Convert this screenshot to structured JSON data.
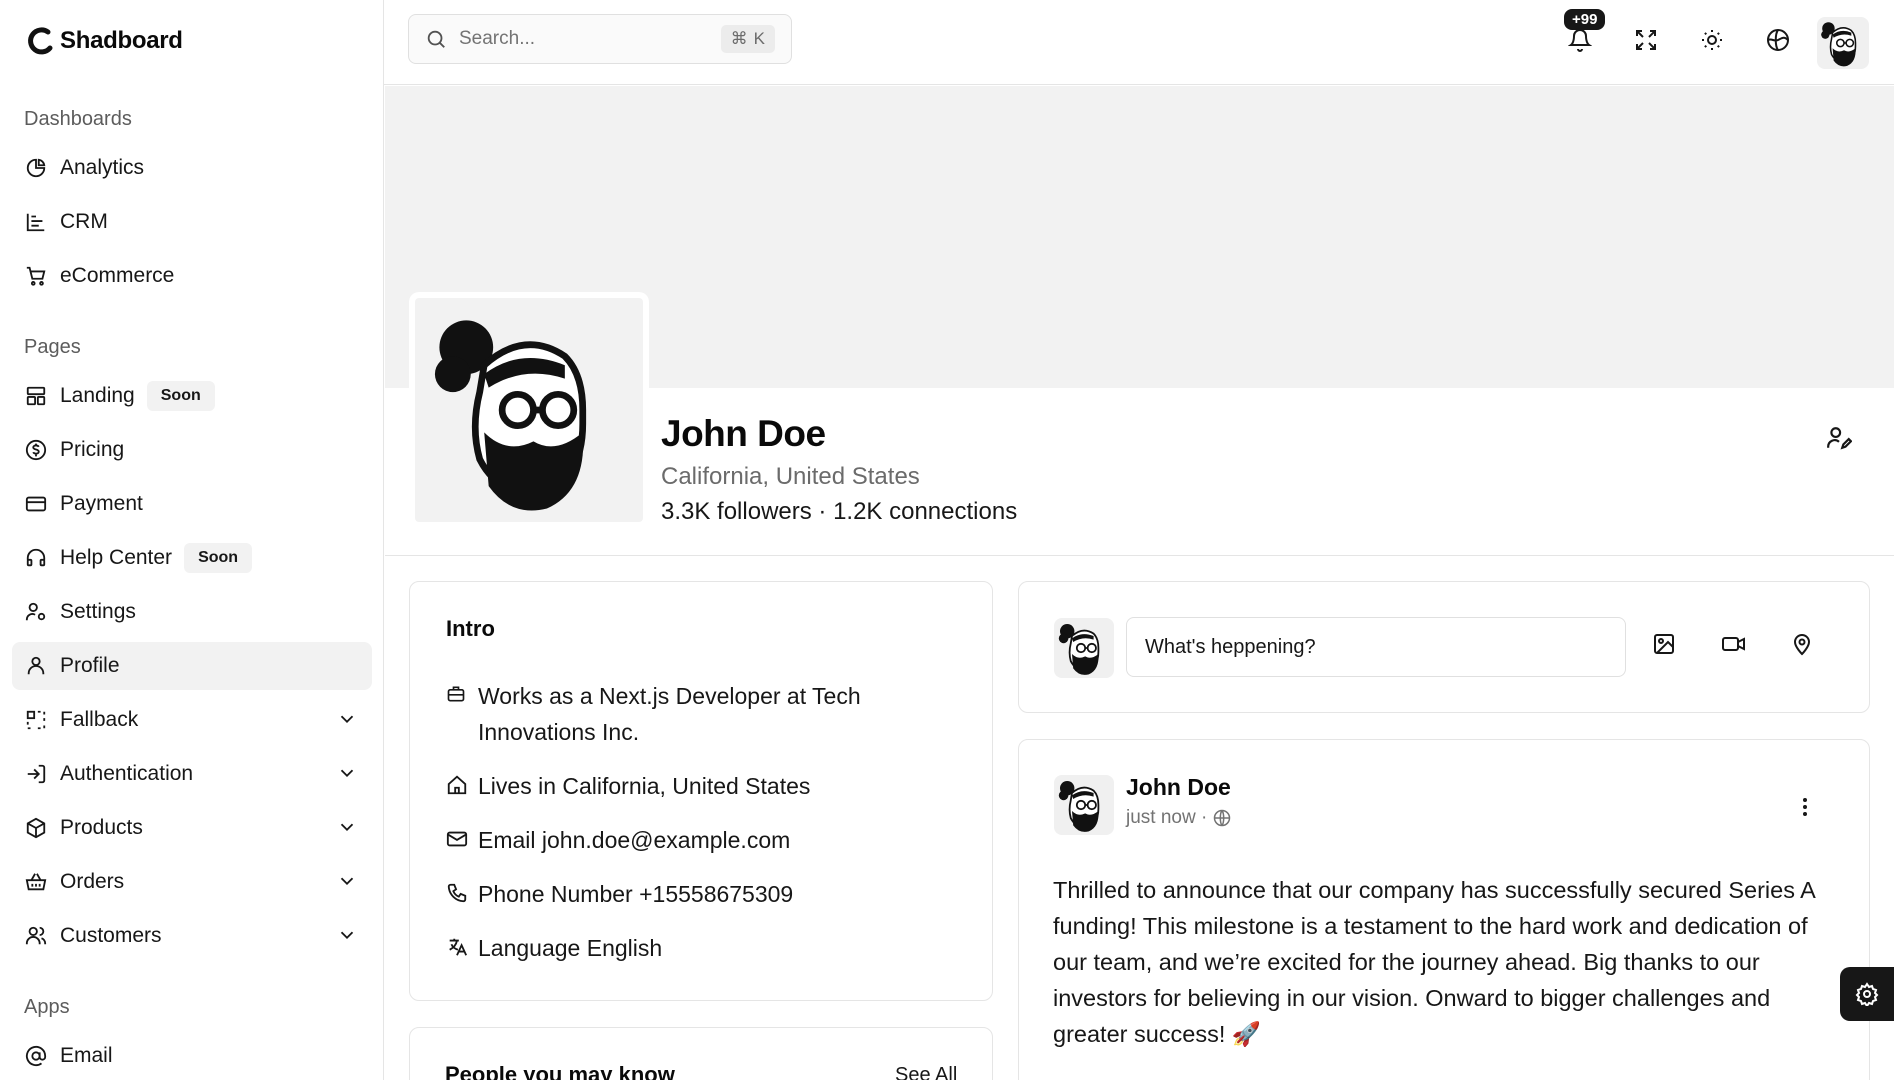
{
  "brand": {
    "name": "Shadboard"
  },
  "sidebar": {
    "groups": [
      {
        "label": "Dashboards"
      },
      {
        "label": "Pages"
      },
      {
        "label": "Apps"
      }
    ],
    "items": [
      {
        "label": "Analytics",
        "icon": "pie-chart-icon"
      },
      {
        "label": "CRM",
        "icon": "bar-chart-icon"
      },
      {
        "label": "eCommerce",
        "icon": "cart-icon"
      },
      {
        "label": "Landing",
        "icon": "layout-icon",
        "badge": "Soon"
      },
      {
        "label": "Pricing",
        "icon": "dollar-circle-icon"
      },
      {
        "label": "Payment",
        "icon": "credit-card-icon"
      },
      {
        "label": "Help Center",
        "icon": "headset-icon",
        "badge": "Soon"
      },
      {
        "label": "Settings",
        "icon": "user-cog-icon"
      },
      {
        "label": "Profile",
        "icon": "user-icon",
        "active": true
      },
      {
        "label": "Fallback",
        "icon": "fallback-icon",
        "expandable": true
      },
      {
        "label": "Authentication",
        "icon": "login-icon",
        "expandable": true
      },
      {
        "label": "Products",
        "icon": "package-icon",
        "expandable": true
      },
      {
        "label": "Orders",
        "icon": "basket-icon",
        "expandable": true
      },
      {
        "label": "Customers",
        "icon": "users-icon",
        "expandable": true
      },
      {
        "label": "Email",
        "icon": "at-sign-icon"
      }
    ]
  },
  "topbar": {
    "search_placeholder": "Search...",
    "shortcut_symbol": "⌘",
    "shortcut_key": "K",
    "notifications_badge": "+99"
  },
  "profile": {
    "name": "John Doe",
    "location": "California, United States",
    "stats": "3.3K followers · 1.2K connections"
  },
  "intro": {
    "title": "Intro",
    "work_line1": "Works as a Next.js Developer at Tech",
    "work_line2": "Innovations Inc.",
    "lives": "Lives in California, United States",
    "email": "Email john.doe@example.com",
    "phone": "Phone Number +15558675309",
    "language": "Language English"
  },
  "composer": {
    "placeholder": "What's heppening?"
  },
  "post": {
    "author": "John Doe",
    "time": "just now ·",
    "text": "Thrilled to announce that our company has successfully secured Series A funding! This milestone is a testament to the hard work and dedication of our team, and we’re excited for the journey ahead. Big thanks to our investors for believing in our vision. Onward to bigger challenges and greater success! 🚀"
  },
  "people": {
    "title": "People you may know",
    "see_all": "See All"
  },
  "colors": {
    "accent": "#171717",
    "cover": "#f2f2f2",
    "border": "#e5e5e5",
    "muted": "#6b6b6b"
  }
}
